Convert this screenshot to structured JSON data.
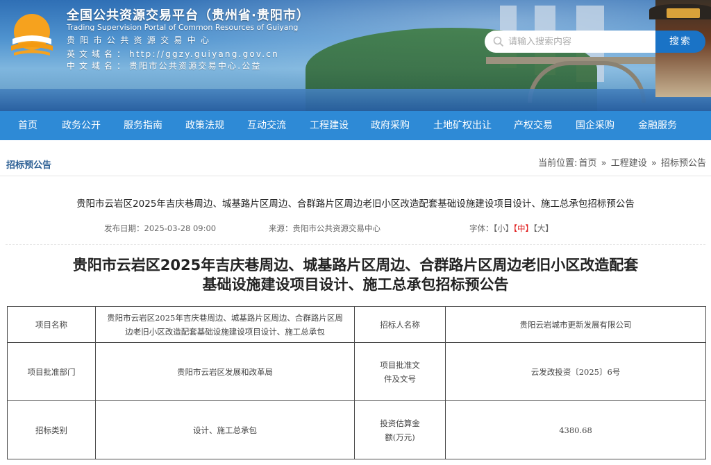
{
  "header": {
    "title": "全国公共资源交易平台（贵州省·贵阳市）",
    "subtitle_en": "Trading Supervision Portal of Common Resources of Guiyang",
    "center_name": "贵阳市公共资源交易中心",
    "en_domain_label": "英文域名：",
    "en_domain_value": "http://ggzy.guiyang.gov.cn",
    "cn_domain_label": "中文域名：",
    "cn_domain_value": "贵阳市公共资源交易中心.公益"
  },
  "search": {
    "placeholder": "请输入搜索内容",
    "button_label": "搜索"
  },
  "nav": {
    "items": [
      "首页",
      "政务公开",
      "服务指南",
      "政策法规",
      "互动交流",
      "工程建设",
      "政府采购",
      "土地矿权出让",
      "产权交易",
      "国企采购",
      "金融服务"
    ]
  },
  "breadcrumb": {
    "section_title": "招标预公告",
    "prefix": "当前位置:",
    "home": "首页",
    "sep": "»",
    "level1": "工程建设",
    "level2": "招标预公告"
  },
  "article": {
    "title": "贵阳市云岩区2025年吉庆巷周边、城基路片区周边、合群路片区周边老旧小区改造配套基础设施建设项目设计、施工总承包招标预公告",
    "publish_date": "发布日期：2025-03-28 09:00",
    "source": "来源：贵阳市公共资源交易中心",
    "font_label": "字体：",
    "font_small": "【小】",
    "font_medium": "【中】",
    "font_large": "【大】",
    "heading_line1": "贵阳市云岩区2025年吉庆巷周边、城基路片区周边、合群路片区周边老旧小区改造配套",
    "heading_line2": "基础设施建设项目设计、施工总承包招标预公告"
  },
  "table": {
    "rows": [
      {
        "label1": "项目名称",
        "value1_line1": "贵阳市云岩区2025年吉庆巷周边、城基路片区周边、合群路片区周",
        "value1_line2": "边老旧小区改造配套基础设施建设项目设计、施工总承包",
        "label2": "招标人名称",
        "value2": "贵阳云岩城市更新发展有限公司"
      },
      {
        "label1": "项目批准部门",
        "value1": "贵阳市云岩区发展和改革局",
        "label2_line1": "项目批准文",
        "label2_line2": "件及文号",
        "value2": "云发改投资〔2025〕6号"
      },
      {
        "label1": "招标类别",
        "value1": "设计、施工总承包",
        "label2_line1": "投资估算金",
        "label2_line2": "额(万元)",
        "value2": "4380.68"
      }
    ]
  }
}
